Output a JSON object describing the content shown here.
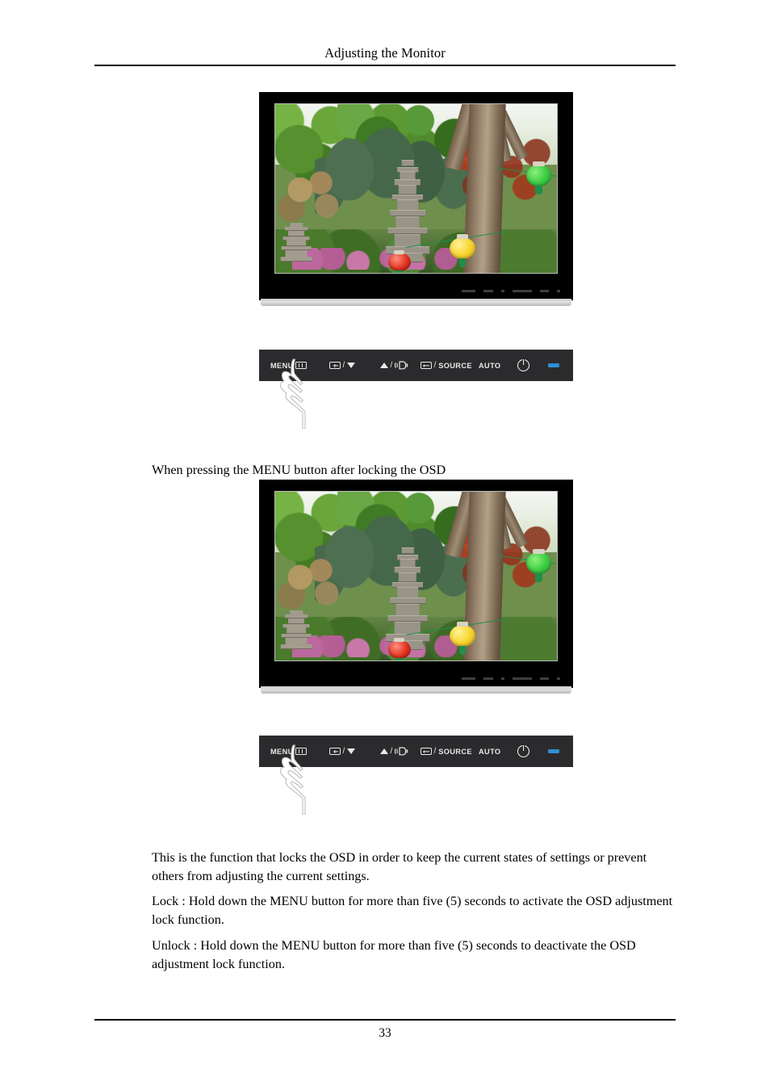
{
  "page": {
    "header_title": "Adjusting the Monitor",
    "page_number": "33"
  },
  "caption": {
    "text": "When pressing the MENU button after locking the OSD"
  },
  "paragraphs": {
    "intro": "This is the function that locks the OSD in order to keep the current states of settings or prevent others from adjusting the current settings.",
    "lock": "Lock : Hold down the MENU button for more than five (5) seconds to activate the OSD adjustment lock function.",
    "unlock": "Unlock : Hold down the MENU button for more than five (5) seconds to deactivate the OSD adjustment lock function."
  },
  "figures": [
    {
      "id": "monitor-top",
      "screen_content": "Garden photograph with stone pagoda, pine trees and hanging paper lanterns"
    },
    {
      "id": "monitor-bottom",
      "screen_content": "Garden photograph with stone pagoda, pine trees and hanging paper lanterns"
    }
  ],
  "control_bar": {
    "buttons": [
      {
        "name": "menu",
        "label": "MENU",
        "icon": "menu-icon"
      },
      {
        "name": "minus-down",
        "label": "",
        "icon": "plus-box-icon",
        "separator": "/",
        "secondary_icon": "triangle-down-icon"
      },
      {
        "name": "plus-up",
        "label": "",
        "icon": "triangle-up-icon",
        "separator": "/",
        "secondary_icon": "speaker-icon"
      },
      {
        "name": "source",
        "label": "SOURCE",
        "icon": "enter-icon",
        "separator": "/"
      },
      {
        "name": "auto",
        "label": "AUTO",
        "icon": ""
      },
      {
        "name": "power",
        "label": "",
        "icon": "power-icon"
      },
      {
        "name": "led",
        "label": "",
        "icon": "led-indicator"
      }
    ],
    "hand_pointer": "hand-pressing-menu-icon"
  },
  "colors": {
    "bar_background": "#2b2b2d",
    "bar_text": "#e9e9ea",
    "led_blue": "#2f8ed6",
    "bezel": "#000000",
    "base": "#cfd2d0"
  }
}
